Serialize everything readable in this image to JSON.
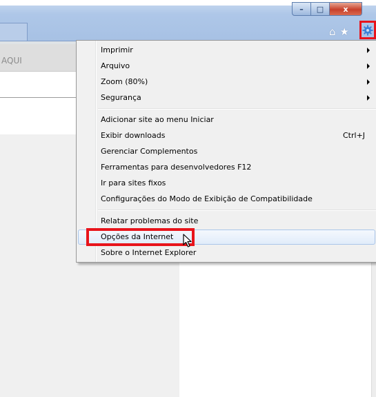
{
  "window": {
    "controls": {
      "minimize": "–",
      "maximize": "□",
      "close": "x"
    },
    "icons": [
      "home-icon",
      "favorites-star-icon",
      "tools-gear-icon"
    ]
  },
  "page": {
    "aqui_text": "AQUI"
  },
  "menu": {
    "groups": [
      [
        {
          "label": "Imprimir",
          "submenu": true
        },
        {
          "label": "Arquivo",
          "submenu": true
        },
        {
          "label": "Zoom (80%)",
          "submenu": true
        },
        {
          "label": "Segurança",
          "submenu": true
        }
      ],
      [
        {
          "label": "Adicionar site ao menu Iniciar"
        },
        {
          "label": "Exibir downloads",
          "shortcut": "Ctrl+J"
        },
        {
          "label": "Gerenciar Complementos"
        },
        {
          "label": "Ferramentas para desenvolvedores F12"
        },
        {
          "label": "Ir para sites fixos"
        },
        {
          "label": "Configurações do Modo de Exibição de Compatibilidade"
        }
      ],
      [
        {
          "label": "Relatar problemas do site"
        },
        {
          "label": "Opções da Internet",
          "highlighted": true
        },
        {
          "label": "Sobre o Internet Explorer"
        }
      ]
    ]
  },
  "colors": {
    "highlight_box": "#e8141b",
    "titlebar": "#aec7e8",
    "menu_bg": "#f0f0f0"
  }
}
